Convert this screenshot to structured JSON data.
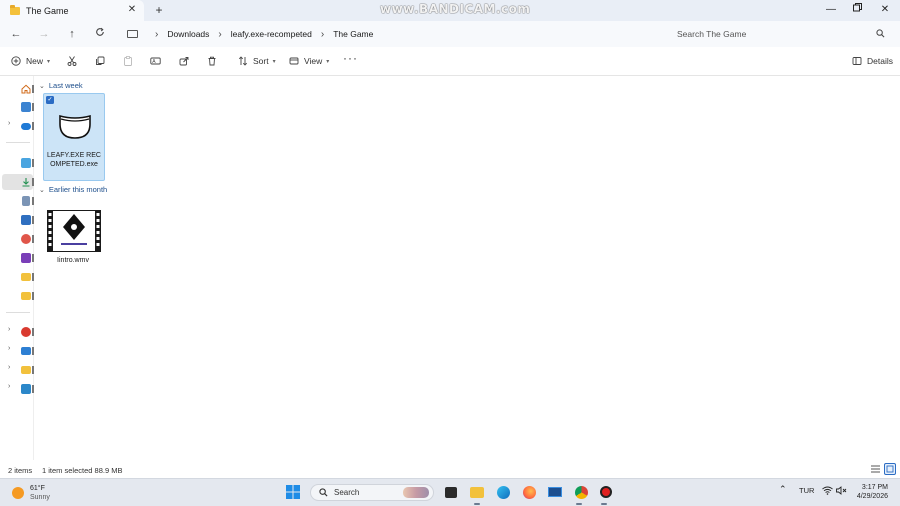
{
  "tab": {
    "title": "The Game"
  },
  "watermark": "www.BANDICAM.com",
  "breadcrumb": [
    "Downloads",
    "leafy.exe-recompeted",
    "The Game"
  ],
  "search": {
    "placeholder": "Search The Game"
  },
  "commands": {
    "new": "New",
    "sort": "Sort",
    "view": "View",
    "details": "Details"
  },
  "groups": [
    {
      "label": "Last week",
      "files": [
        {
          "name": "LEAFY.EXE RECOMPETED.exe",
          "selected": true
        }
      ]
    },
    {
      "label": "Earlier this month",
      "files": [
        {
          "name": "Iintro.wmv",
          "selected": false
        }
      ]
    }
  ],
  "status": {
    "items": "2 items",
    "selected": "1 item selected  88.9 MB"
  },
  "taskbar": {
    "weather_temp": "61°F",
    "weather_desc": "Sunny",
    "search_label": "Search",
    "language": "TUR",
    "time": "3:17 PM",
    "date": "4/29/2026"
  }
}
